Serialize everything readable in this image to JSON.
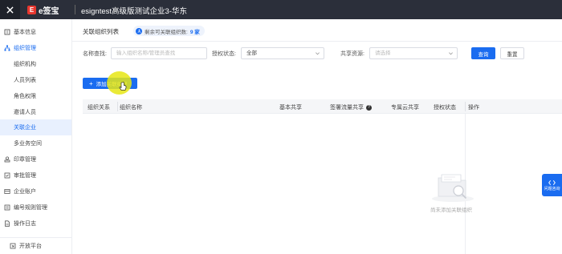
{
  "topbar": {
    "close_icon": "close-icon",
    "logo_mark": "E",
    "logo_text": "e签宝",
    "title": "esigntest高级版测试企业3-华东"
  },
  "sidebar": {
    "items": [
      {
        "label": "基本信息",
        "icon": "building-icon"
      },
      {
        "label": "组织管理",
        "icon": "org-icon"
      },
      {
        "label": "组织机构"
      },
      {
        "label": "人员列表"
      },
      {
        "label": "角色权限"
      },
      {
        "label": "邀请人员"
      },
      {
        "label": "关联企业"
      },
      {
        "label": "多业务空间"
      },
      {
        "label": "印章管理",
        "icon": "seal-icon"
      },
      {
        "label": "审批管理",
        "icon": "approval-icon"
      },
      {
        "label": "企业账户",
        "icon": "account-icon"
      },
      {
        "label": "编号规则管理",
        "icon": "number-rule-icon"
      },
      {
        "label": "操作日志",
        "icon": "log-icon"
      }
    ],
    "footer": {
      "label": "开放平台",
      "icon": "open-platform-icon"
    }
  },
  "main": {
    "title": "关联组织列表",
    "pill": {
      "text": "剩余可关联组织数:",
      "count": "9 家"
    },
    "filters": {
      "name_label": "名称查找:",
      "name_placeholder": "输入组织名称/管理员查找",
      "auth_label": "授权状态:",
      "auth_value": "全部",
      "share_label": "共享资源:",
      "share_placeholder": "请选择",
      "search_button": "查询",
      "reset_button": "重置"
    },
    "add_button": "添加关联组织",
    "table": {
      "columns": [
        "组织关系",
        "组织名称",
        "基本共享",
        "签署流量共享",
        "专属云共享",
        "授权状态",
        "操作"
      ]
    },
    "empty_text": "尚未添加关联组织"
  },
  "float_button": {
    "label": "问题咨询"
  },
  "colors": {
    "accent": "#1a6cf0",
    "topbar": "#2b2f3a",
    "highlight": "#e6e614"
  }
}
